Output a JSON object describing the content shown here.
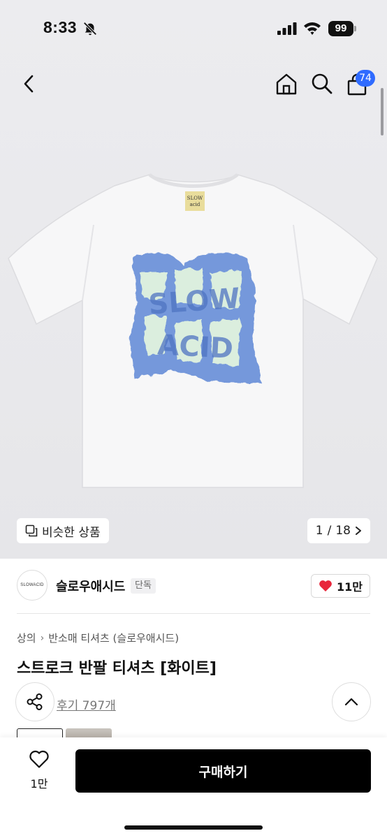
{
  "status_bar": {
    "time": "8:33",
    "battery": "99"
  },
  "nav": {
    "cart_count": "74"
  },
  "gallery": {
    "similar_label": "비슷한 상품",
    "current_page": "1",
    "page_sep": "/",
    "total_pages": "18",
    "print_text": "SLOW ACID",
    "colors": {
      "print_blue": "#6f93d9",
      "print_fill": "#dbeede",
      "shirt": "#f7f7f8"
    }
  },
  "brand": {
    "logo_text": "SLOWACID",
    "name": "슬로우애시드",
    "badge": "단독",
    "like_count": "11만"
  },
  "product": {
    "breadcrumb": [
      "상의",
      "반소매 티셔츠 (슬로우애시드)"
    ],
    "title": "스트로크 반팔 티셔츠 [화이트]",
    "review_label": "후기 797개"
  },
  "bottom": {
    "wish_count": "1만",
    "buy_label": "구매하기"
  },
  "colors": {
    "accent": "#2f6bff",
    "like_heart": "#e8263b",
    "buy_button": "#000000"
  }
}
